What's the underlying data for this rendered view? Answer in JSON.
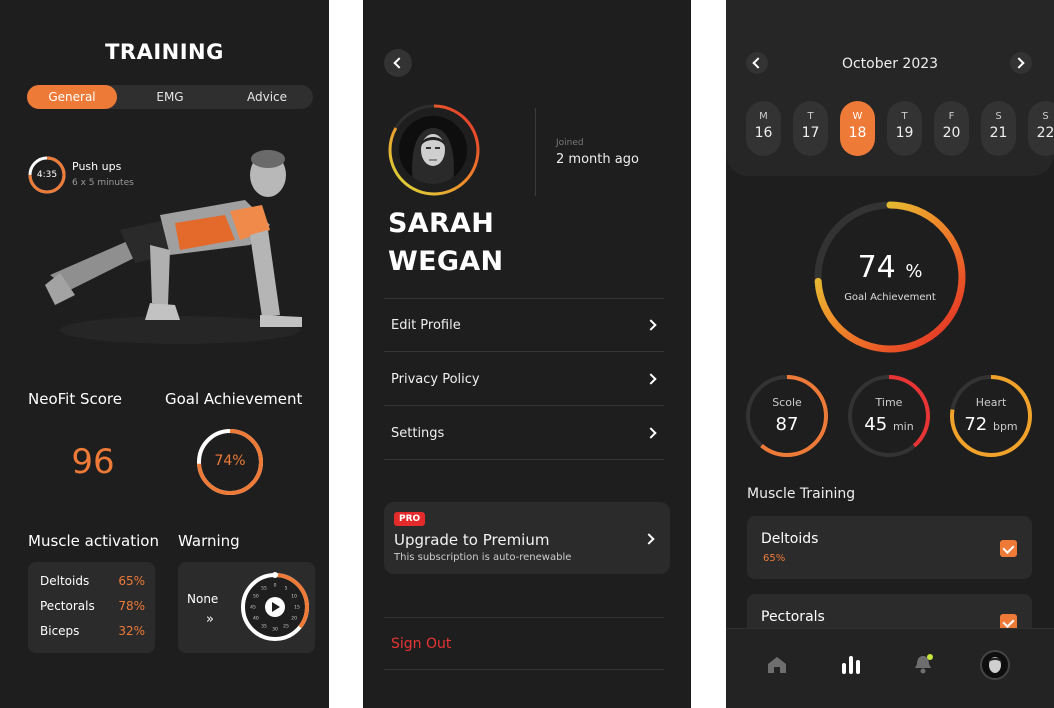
{
  "training": {
    "title": "TRAINING",
    "tabs": [
      "General",
      "EMG",
      "Advice"
    ],
    "exercise": {
      "time": "4:35",
      "name": "Push ups",
      "sets": "6 x 5 minutes",
      "progress": 0.75
    },
    "neofit_label": "NeoFit Score",
    "neofit_value": "96",
    "goal_label": "Goal Achievement",
    "goal_value": "74%",
    "goal_fraction": 0.74,
    "muscle_label": "Muscle activation",
    "muscles": [
      {
        "name": "Deltoids",
        "value": "65%"
      },
      {
        "name": "Pectorals",
        "value": "78%"
      },
      {
        "name": "Biceps",
        "value": "32%"
      }
    ],
    "warning_label": "Warning",
    "warning_value": "None",
    "warning_arrow": "»",
    "dial_numbers": [
      "50",
      "55",
      "0",
      "5",
      "10",
      "15",
      "20",
      "25",
      "30",
      "35",
      "40",
      "45"
    ]
  },
  "profile": {
    "joined_label": "Joined",
    "joined_value": "2 month ago",
    "first_name": "SARAH",
    "last_name": "WEGAN",
    "menu": [
      "Edit Profile",
      "Privacy Policy",
      "Settings"
    ],
    "pro_badge": "PRO",
    "premium_title": "Upgrade to Premium",
    "premium_sub": "This subscription is auto-renewable",
    "sign_out": "Sign Out"
  },
  "stats": {
    "month": "October 2023",
    "days": [
      {
        "l": "M",
        "n": "16"
      },
      {
        "l": "T",
        "n": "17"
      },
      {
        "l": "W",
        "n": "18"
      },
      {
        "l": "T",
        "n": "19"
      },
      {
        "l": "F",
        "n": "20"
      },
      {
        "l": "S",
        "n": "21"
      },
      {
        "l": "S",
        "n": "22"
      }
    ],
    "goal_value": "74",
    "goal_unit": "%",
    "goal_label": "Goal Achievement",
    "score_label": "Scole",
    "score_value": "87",
    "time_label": "Time",
    "time_value": "45",
    "time_unit": "min",
    "heart_label": "Heart",
    "heart_value": "72",
    "heart_unit": "bpm",
    "muscle_title": "Muscle Training",
    "muscle_cards": [
      {
        "name": "Deltoids",
        "value": "65%"
      },
      {
        "name": "Pectorals",
        "value": ""
      }
    ]
  },
  "colors": {
    "accent": "#ee7a38",
    "danger": "#e83434",
    "bg": "#1e1e1e",
    "card": "#2b2b2b"
  },
  "icons": [
    "chevron-left-icon",
    "chevron-right-icon",
    "home-icon",
    "stats-icon",
    "bell-icon",
    "play-icon",
    "check-icon"
  ]
}
